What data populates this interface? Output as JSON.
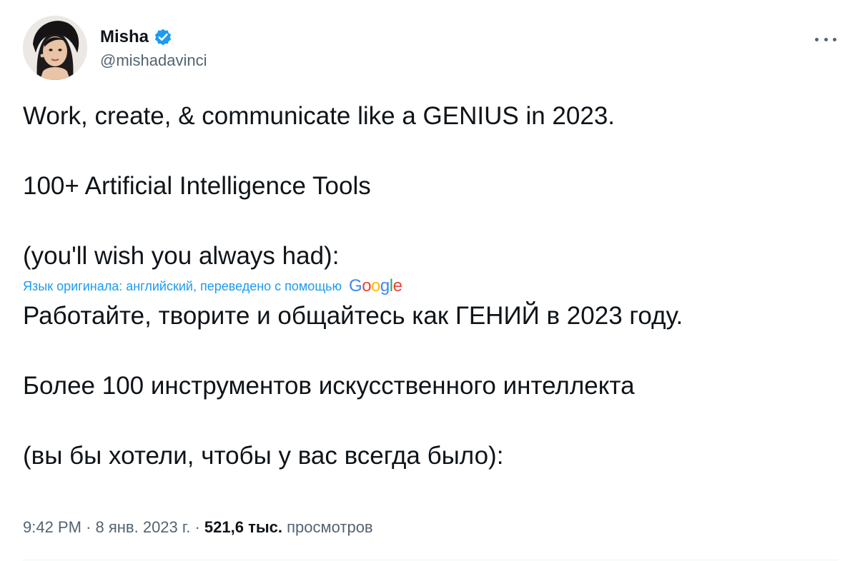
{
  "author": {
    "display_name": "Misha",
    "handle": "@mishadavinci",
    "verified": true
  },
  "tweet": {
    "original_lines": [
      "Work, create, & communicate like a GENIUS in 2023.",
      "100+ Artificial Intelligence Tools",
      "(you'll wish you always had):"
    ],
    "translation_label": "Язык оригинала: английский, переведено с помощью",
    "translator_logo": "Google",
    "translated_lines": [
      "Работайте, творите и общайтесь как ГЕНИЙ в 2023 году.",
      "Более 100 инструментов искусственного интеллекта",
      "(вы бы хотели, чтобы у вас всегда было):"
    ]
  },
  "meta": {
    "time": "9:42 PM",
    "separator": "·",
    "date": "8 янв. 2023 г.",
    "views_count": "521,6 тыс.",
    "views_label": "просмотров"
  },
  "colors": {
    "verified": "#1d9bf0",
    "link": "#1d9bf0",
    "secondary_text": "#536471",
    "primary_text": "#0f1419"
  },
  "icons": {
    "verified": "verified-badge-icon",
    "more": "more-options-icon"
  }
}
